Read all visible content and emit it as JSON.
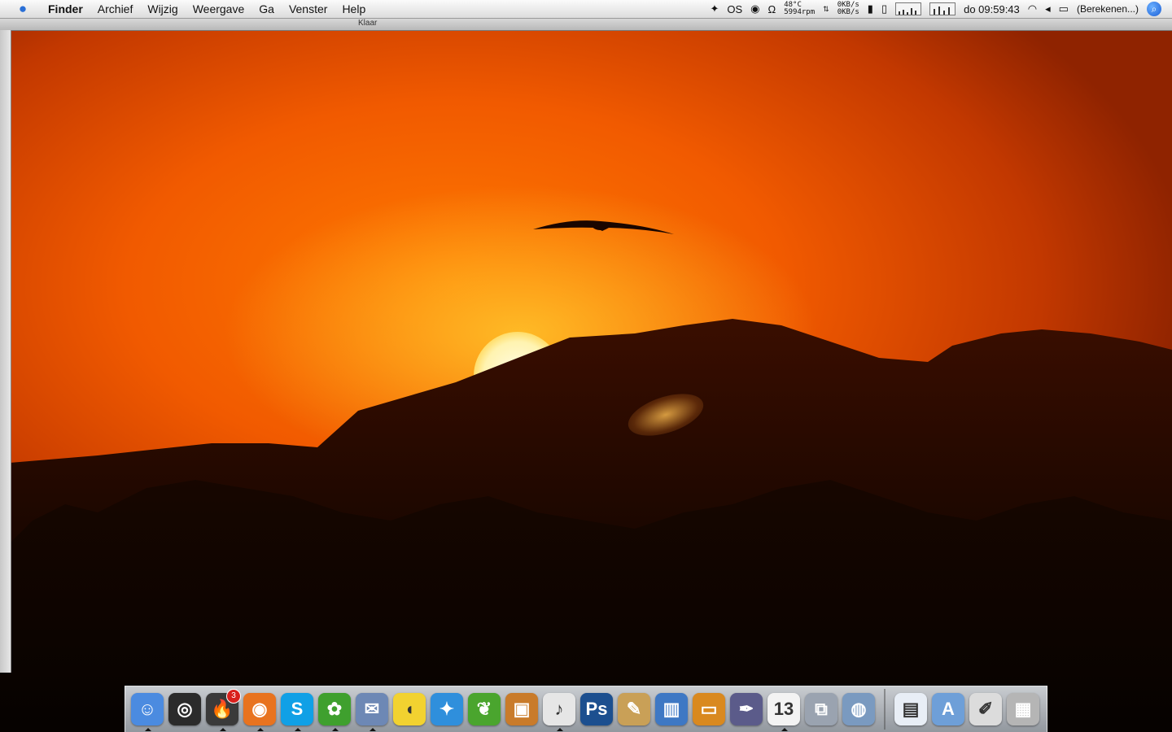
{
  "menubar": {
    "apple_icon": "apple-icon",
    "items": [
      {
        "label": "Finder",
        "bold": true
      },
      {
        "label": "Archief"
      },
      {
        "label": "Wijzig"
      },
      {
        "label": "Weergave"
      },
      {
        "label": "Ga"
      },
      {
        "label": "Venster"
      },
      {
        "label": "Help"
      }
    ],
    "status": {
      "os_label": "OS",
      "temp": "48°C",
      "rpm": "5994rpm",
      "net_up": "0KB/s",
      "net_down": "0KB/s",
      "clock": "do 09:59:43",
      "battery_label": "(Berekenen...)"
    }
  },
  "window": {
    "status_text": "Klaar"
  },
  "dock": {
    "items": [
      {
        "name": "finder",
        "icon": "finder-icon",
        "color": "#4b8be0",
        "glyph": "☺",
        "running": true
      },
      {
        "name": "dashboard",
        "icon": "dashboard-icon",
        "color": "#2b2b2b",
        "glyph": "◎",
        "running": false
      },
      {
        "name": "growl",
        "icon": "fire-icon",
        "color": "#3a3a3a",
        "glyph": "🔥",
        "running": true,
        "badge": "3"
      },
      {
        "name": "firefox",
        "icon": "firefox-icon",
        "color": "#e8731f",
        "glyph": "◉",
        "running": true
      },
      {
        "name": "skype",
        "icon": "skype-icon",
        "color": "#10a0e6",
        "glyph": "S",
        "running": true
      },
      {
        "name": "adium",
        "icon": "adium-icon",
        "color": "#3fa02e",
        "glyph": "✿",
        "running": true
      },
      {
        "name": "mail",
        "icon": "mail-icon",
        "color": "#6d88b5",
        "glyph": "✉",
        "running": true
      },
      {
        "name": "cyberduck",
        "icon": "duck-icon",
        "color": "#f2d230",
        "glyph": "◖",
        "running": false
      },
      {
        "name": "twitterrific",
        "icon": "bird-icon",
        "color": "#2f8fdc",
        "glyph": "✦",
        "running": false
      },
      {
        "name": "coda",
        "icon": "leaf-icon",
        "color": "#4aa52e",
        "glyph": "❦",
        "running": false
      },
      {
        "name": "iphoto",
        "icon": "photo-icon",
        "color": "#c97b2a",
        "glyph": "▣",
        "running": false
      },
      {
        "name": "itunes-album",
        "icon": "album-icon",
        "color": "#e6e6e6",
        "glyph": "♪",
        "running": true
      },
      {
        "name": "photoshop",
        "icon": "photoshop-icon",
        "color": "#1c4f8f",
        "glyph": "Ps",
        "running": false
      },
      {
        "name": "script-editor",
        "icon": "pencil-icon",
        "color": "#c9a057",
        "glyph": "✎",
        "running": false
      },
      {
        "name": "numbers",
        "icon": "chart-icon",
        "color": "#3e78c4",
        "glyph": "▥",
        "running": false
      },
      {
        "name": "keynote",
        "icon": "keynote-icon",
        "color": "#d9891f",
        "glyph": "▭",
        "running": false
      },
      {
        "name": "quill",
        "icon": "quill-icon",
        "color": "#5b5b8a",
        "glyph": "✒",
        "running": false
      },
      {
        "name": "ical",
        "icon": "calendar-icon",
        "color": "#f3f3f3",
        "glyph": "13",
        "running": true
      },
      {
        "name": "vmware",
        "icon": "vm-icon",
        "color": "#9aa3b0",
        "glyph": "⧉",
        "running": false
      },
      {
        "name": "network-utility",
        "icon": "globe-icon",
        "color": "#7a9ac0",
        "glyph": "◍",
        "running": false
      }
    ],
    "right_items": [
      {
        "name": "documents-stack",
        "icon": "document-icon",
        "color": "#e8eef6",
        "glyph": "▤",
        "running": false
      },
      {
        "name": "applications-folder",
        "icon": "folder-icon",
        "color": "#6e9fd8",
        "glyph": "A",
        "running": false
      },
      {
        "name": "script-stack",
        "icon": "script-icon",
        "color": "#dcdcdc",
        "glyph": "✐",
        "running": false
      },
      {
        "name": "trash",
        "icon": "trash-icon",
        "color": "#b5b5b5",
        "glyph": "▦",
        "running": false
      }
    ]
  }
}
